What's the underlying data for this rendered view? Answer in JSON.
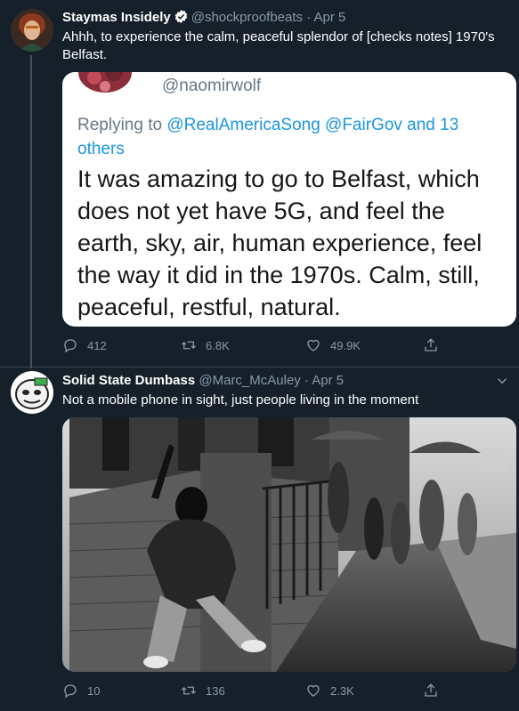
{
  "colors": {
    "bg": "#15202b",
    "muted": "#8899a6",
    "link": "#1b95e0",
    "divider": "#38444d"
  },
  "tweets": [
    {
      "name": "Staymas Insidely",
      "handle": "@shockproofbeats · Apr 5",
      "text": "Ahhh, to experience the calm, peaceful splendor of [checks notes] 1970's Belfast.",
      "quote": {
        "handle": "@naomirwolf",
        "reply_prefix": "Replying to ",
        "reply_targets": "@RealAmericaSong @FairGov and 13 others",
        "body": "It was amazing to go to Belfast, which does not yet have 5G, and feel the earth, sky, air, human experience, feel the way it did in the 1970s. Calm, still, peaceful, restful, natural."
      },
      "replies": "412",
      "retweets": "6.8K",
      "likes": "49.9K"
    },
    {
      "name": "Solid State Dumbass",
      "handle": "@Marc_McAuley · Apr 5",
      "text": "Not a mobile phone in sight, just people living in the moment",
      "replies": "10",
      "retweets": "136",
      "likes": "2.3K"
    }
  ]
}
